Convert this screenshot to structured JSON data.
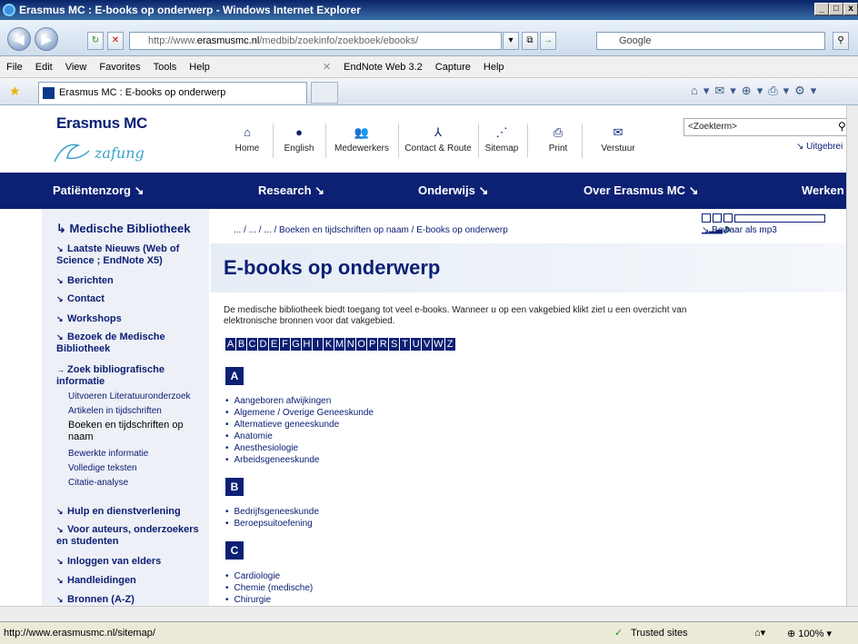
{
  "window": {
    "title": "Erasmus MC : E-books op onderwerp - Windows Internet Explorer",
    "min": "_",
    "max": "□",
    "close": "x"
  },
  "address": {
    "url_prefix": "http://www.",
    "url_domain": "erasmusmc.nl",
    "url_path": "/medbib/zoekinfo/zoekboek/ebooks/",
    "search_placeholder": "Google"
  },
  "menu": {
    "items": [
      "File",
      "Edit",
      "View",
      "Favorites",
      "Tools",
      "Help"
    ],
    "endnote": "EndNote Web 3.2",
    "capture": "Capture",
    "help": "Help"
  },
  "tab": {
    "label": "Erasmus MC : E-books op onderwerp"
  },
  "site": {
    "logo": "Erasmus MC",
    "logo_sig": "zafung",
    "top_icons": [
      {
        "label": "Home"
      },
      {
        "label": "English"
      },
      {
        "label": "Medewerkers"
      },
      {
        "label": "Contact & Route"
      },
      {
        "label": "Sitemap"
      },
      {
        "label": "Print"
      },
      {
        "label": "Verstuur"
      }
    ],
    "search_placeholder": "<Zoekterm>",
    "uitgebreid": "Uitgebrei",
    "nav": [
      "Patiëntenzorg ↘",
      "Research ↘",
      "Onderwijs ↘",
      "Over Erasmus MC ↘",
      "Werken"
    ]
  },
  "sidebar": {
    "title": "Medische Bibliotheek",
    "items": [
      {
        "label": "Laatste Nieuws (Web of Science ; EndNote X5)"
      },
      {
        "label": "Berichten"
      },
      {
        "label": "Contact"
      },
      {
        "label": "Workshops"
      },
      {
        "label": "Bezoek de Medische Bibliotheek"
      },
      {
        "label": "Zoek bibliografische informatie"
      }
    ],
    "subitems": [
      "Uitvoeren Literatuuronderzoek",
      "Artikelen in tijdschriften",
      "Boeken en tijdschriften op naam",
      "Bewerkte informatie",
      "Volledige teksten",
      "Citatie-analyse"
    ],
    "items2": [
      {
        "label": "Hulp en dienstverlening"
      },
      {
        "label": "Voor auteurs, onderzoekers en studenten"
      },
      {
        "label": "Inloggen van elders"
      },
      {
        "label": "Handleidingen"
      },
      {
        "label": "Bronnen (A-Z)"
      }
    ]
  },
  "content": {
    "breadcrumb": "... / ... / ... / Boeken en tijdschriften op naam / E-books op onderwerp",
    "mp3": "Bewaar als mp3",
    "title": "E-books op onderwerp",
    "intro": "De medische bibliotheek biedt toegang tot veel e-books. Wanneer u op een vakgebied klikt ziet u een overzicht van elektronische bronnen voor dat vakgebied.",
    "alphabet": [
      "A",
      "B",
      "C",
      "D",
      "E",
      "F",
      "G",
      "H",
      "I",
      "K",
      "M",
      "N",
      "O",
      "P",
      "R",
      "S",
      "T",
      "U",
      "V",
      "W",
      "Z"
    ],
    "sections": [
      {
        "letter": "A",
        "items": [
          "Aangeboren afwijkingen",
          "Algemene / Overige Geneeskunde",
          "Alternatieve geneeskunde",
          "Anatomie",
          "Anesthesiologie",
          "Arbeidsgeneeskunde"
        ]
      },
      {
        "letter": "B",
        "items": [
          "Bedrijfsgeneeskunde",
          "Beroepsuitoefening"
        ]
      },
      {
        "letter": "C",
        "items": [
          "Cardiologie",
          "Chemie (medische)",
          "Chirurgie"
        ]
      }
    ]
  },
  "status": {
    "url": "http://www.erasmusmc.nl/sitemap/",
    "zone": "Trusted sites",
    "zoom": "100%"
  }
}
